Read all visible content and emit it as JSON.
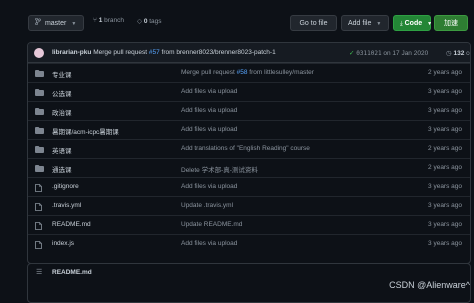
{
  "toolbar": {
    "branch_label": "master",
    "branch_count": "1",
    "branch_word": "branch",
    "tags_count": "0",
    "tags_word": "tags",
    "goto_file": "Go to file",
    "add_file": "Add file",
    "code": "Code",
    "extra": "加速"
  },
  "commit": {
    "author": "librarian-pku",
    "msg_pre": "Merge pull request",
    "pr": "#57",
    "msg_post": "from brenner8023/brenner8023-patch-1",
    "sha": "0311021",
    "date": "on 17 Jan 2020",
    "commit_count": "132",
    "commits_word": "commits"
  },
  "files": [
    {
      "type": "dir",
      "name": "专业课",
      "msg_pre": "Merge pull request ",
      "pr": "#58",
      "msg_post": " from littlesulley/master",
      "age": "2 years ago"
    },
    {
      "type": "dir",
      "name": "公选课",
      "msg": "Add files via upload",
      "age": "3 years ago"
    },
    {
      "type": "dir",
      "name": "政治课",
      "msg": "Add files via upload",
      "age": "3 years ago"
    },
    {
      "type": "dir",
      "name": "暑期课/acm-icpc暑期课",
      "msg": "Add files via upload",
      "age": "3 years ago"
    },
    {
      "type": "dir",
      "name": "英语课",
      "msg": "Add translations of \"English Reading\" course",
      "age": "2 years ago"
    },
    {
      "type": "dir",
      "name": "通选课",
      "msg": "Delete 学术部-真-测试资料",
      "age": "2 years ago"
    },
    {
      "type": "file",
      "name": ".gitignore",
      "msg": "Add files via upload",
      "age": "3 years ago"
    },
    {
      "type": "file",
      "name": ".travis.yml",
      "msg": "Update .travis.yml",
      "age": "3 years ago"
    },
    {
      "type": "file",
      "name": "README.md",
      "msg": "Update README.md",
      "age": "3 years ago"
    },
    {
      "type": "file",
      "name": "index.js",
      "msg": "Add files via upload",
      "age": "3 years ago"
    }
  ],
  "readme": {
    "title": "README.md"
  },
  "watermark": "CSDN @Alienware^"
}
